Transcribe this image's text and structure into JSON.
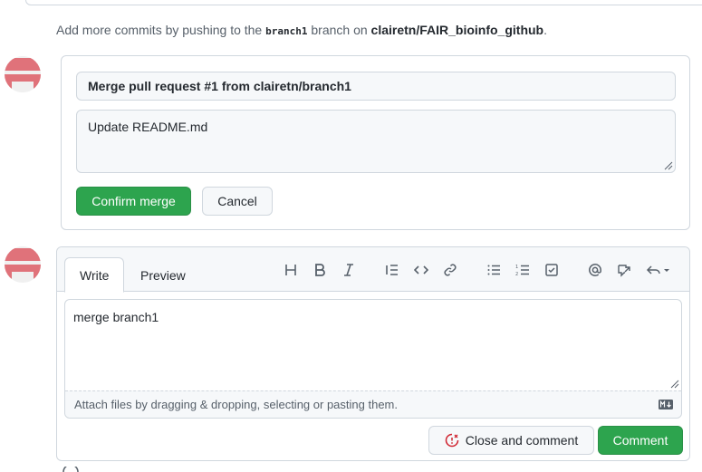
{
  "push_note": {
    "prefix": "Add more commits by pushing to the",
    "branch": "branch1",
    "middle": "branch on",
    "repo": "clairetn/FAIR_bioinfo_github",
    "suffix": "."
  },
  "merge": {
    "title_value": "Merge pull request #1 from clairetn/branch1",
    "body_value": "Update README.md",
    "confirm_label": "Confirm merge",
    "cancel_label": "Cancel"
  },
  "comment": {
    "tabs": [
      "Write",
      "Preview"
    ],
    "toolbar_icons": [
      "heading-icon",
      "bold-icon",
      "italic-icon",
      "quote-icon",
      "code-icon",
      "link-icon",
      "unordered-list-icon",
      "ordered-list-icon",
      "task-list-icon",
      "mention-icon",
      "cross-reference-icon",
      "reply-icon"
    ],
    "text_value": "merge branch1",
    "attach_hint": "Attach files by dragging & dropping, selecting or pasting them.",
    "close_label": "Close and comment",
    "comment_label": "Comment"
  },
  "colors": {
    "accent_green": "#2da44e",
    "border": "#d0d7de",
    "avatar_red": "#e0727a",
    "close_icon_red": "#cf222e"
  }
}
